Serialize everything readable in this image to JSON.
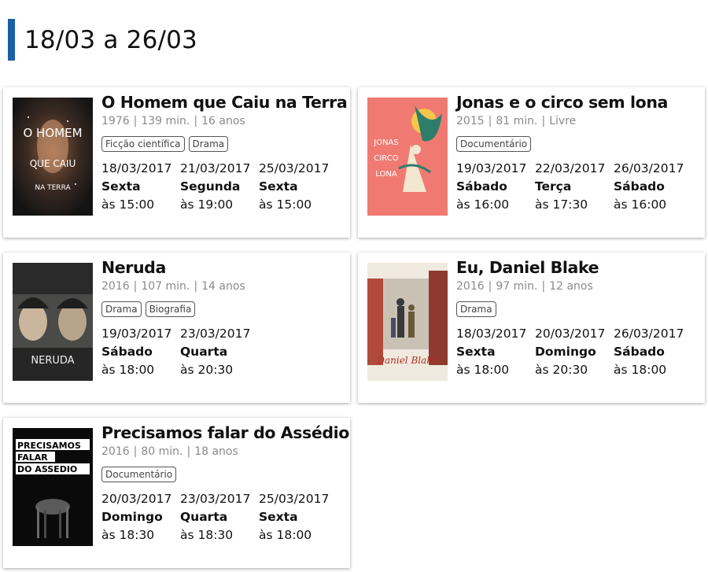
{
  "header": {
    "title": "18/03 a 26/03",
    "accent": "#1a5ea8"
  },
  "movies": [
    {
      "title": "O Homem que Caiu na Terra",
      "year": "1976",
      "duration": "139 min.",
      "rating": "16 anos",
      "genres": [
        "Ficção científica",
        "Drama"
      ],
      "poster_text": [
        "O HOMEM",
        "QUE CAIU",
        "NA TERRA"
      ],
      "sessions": [
        {
          "date": "18/03/2017",
          "day": "Sexta",
          "time": "às 15:00"
        },
        {
          "date": "21/03/2017",
          "day": "Segunda",
          "time": "às 19:00"
        },
        {
          "date": "25/03/2017",
          "day": "Sexta",
          "time": "às 15:00"
        }
      ]
    },
    {
      "title": "Jonas e o circo sem lona",
      "year": "2015",
      "duration": "81 min.",
      "rating": "Livre",
      "genres": [
        "Documentário"
      ],
      "poster_text": [
        "JONAS",
        "CIRCO",
        "LONA"
      ],
      "sessions": [
        {
          "date": "19/03/2017",
          "day": "Sábado",
          "time": "às 16:00"
        },
        {
          "date": "22/03/2017",
          "day": "Terça",
          "time": "às 17:30"
        },
        {
          "date": "26/03/2017",
          "day": "Sábado",
          "time": "às 16:00"
        }
      ]
    },
    {
      "title": "Neruda",
      "year": "2016",
      "duration": "107 min.",
      "rating": "14 anos",
      "genres": [
        "Drama",
        "Biografia"
      ],
      "poster_text": [
        "NERUDA"
      ],
      "sessions": [
        {
          "date": "19/03/2017",
          "day": "Sábado",
          "time": "às 18:00"
        },
        {
          "date": "23/03/2017",
          "day": "Quarta",
          "time": "às 20:30"
        }
      ]
    },
    {
      "title": "Eu, Daniel Blake",
      "year": "2016",
      "duration": "97 min.",
      "rating": "12 anos",
      "genres": [
        "Drama"
      ],
      "poster_text": [
        "Daniel Blake"
      ],
      "sessions": [
        {
          "date": "18/03/2017",
          "day": "Sexta",
          "time": "às 18:00"
        },
        {
          "date": "20/03/2017",
          "day": "Domingo",
          "time": "às 20:30"
        },
        {
          "date": "26/03/2017",
          "day": "Sábado",
          "time": "às 18:00"
        }
      ]
    },
    {
      "title": "Precisamos falar do Assédio",
      "year": "2016",
      "duration": "80 min.",
      "rating": "18 anos",
      "genres": [
        "Documentário"
      ],
      "poster_text": [
        "PRECISAMOS",
        "FALAR",
        "DO ASSEDIO"
      ],
      "sessions": [
        {
          "date": "20/03/2017",
          "day": "Domingo",
          "time": "às 18:30"
        },
        {
          "date": "23/03/2017",
          "day": "Quarta",
          "time": "às 18:30"
        },
        {
          "date": "25/03/2017",
          "day": "Sexta",
          "time": "às 18:00"
        }
      ]
    }
  ]
}
